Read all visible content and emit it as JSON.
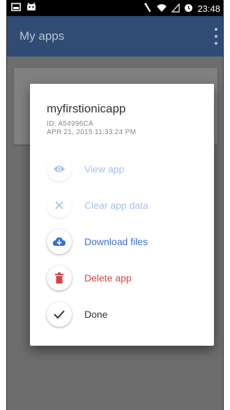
{
  "status_bar": {
    "time": "23:48",
    "icons": [
      "image-icon",
      "android-icon",
      "rotate-icon",
      "wifi-icon",
      "signal-icon",
      "alarm-icon"
    ]
  },
  "app_bar": {
    "title": "My apps",
    "menu_icon": "overflow-menu-icon"
  },
  "dialog": {
    "app_name": "myfirstionicapp",
    "app_id": "ID: A54996CA",
    "date": "APR 21, 2015 11:33:24 PM",
    "actions": [
      {
        "label": "View app",
        "icon": "eye-icon",
        "state": "disabled",
        "color": "#a8c1ee"
      },
      {
        "label": "Clear app data",
        "icon": "close-icon",
        "state": "disabled",
        "color": "#a8c1ee"
      },
      {
        "label": "Download files",
        "icon": "cloud-download-icon",
        "state": "enabled",
        "color": "#3b6fd6"
      },
      {
        "label": "Delete app",
        "icon": "trash-icon",
        "state": "enabled",
        "color": "#d64541"
      },
      {
        "label": "Done",
        "icon": "check-icon",
        "state": "enabled",
        "color": "#333333"
      }
    ]
  },
  "colors": {
    "app_bar": "#304c75",
    "overlay": "#6d6d6d",
    "primary": "#3b6fd6",
    "danger": "#d64541"
  }
}
